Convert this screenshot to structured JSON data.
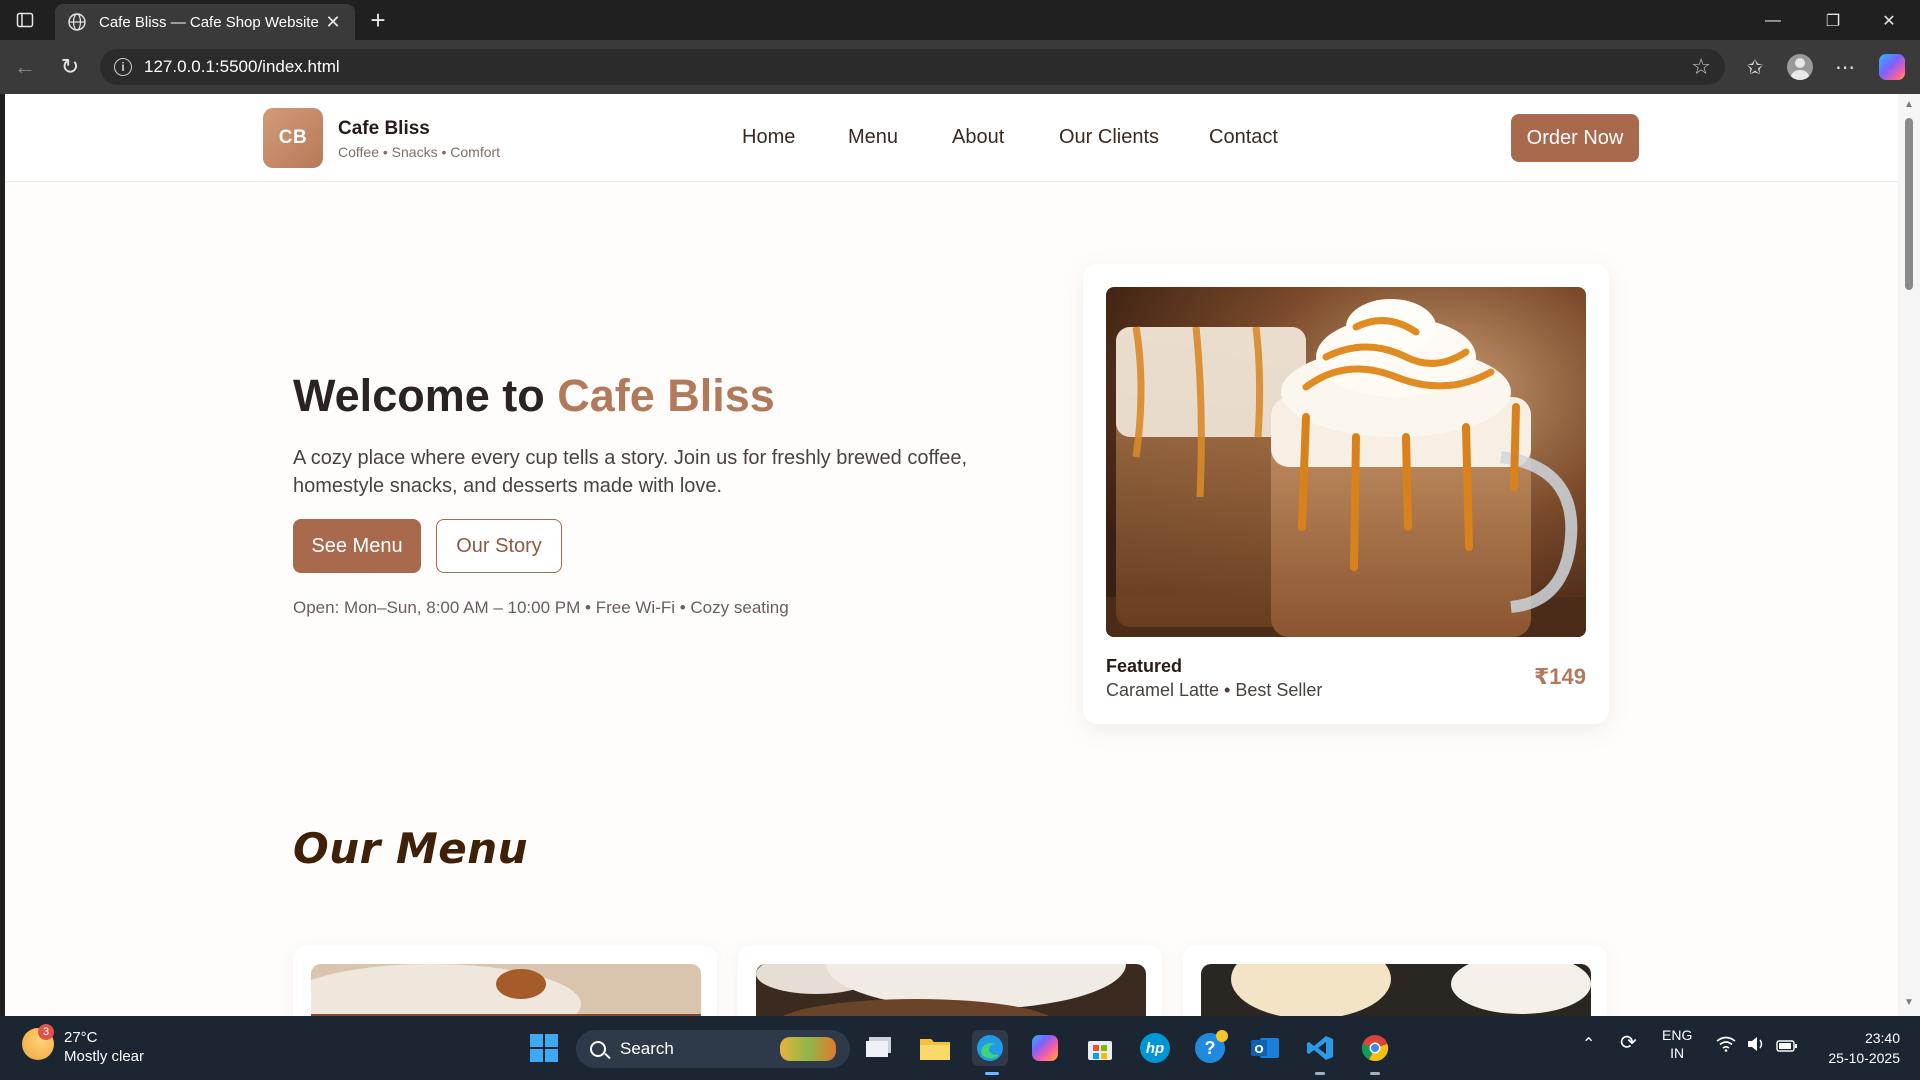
{
  "browser": {
    "tab_title": "Cafe Bliss — Cafe Shop Website",
    "url": "127.0.0.1:5500/index.html"
  },
  "site": {
    "logo_initials": "CB",
    "brand_name": "Cafe Bliss",
    "brand_tagline": "Coffee • Snacks • Comfort",
    "nav": [
      "Home",
      "Menu",
      "About",
      "Our Clients",
      "Contact"
    ],
    "order_button": "Order Now"
  },
  "hero": {
    "title_prefix": "Welcome to ",
    "title_accent": "Cafe Bliss",
    "description": "A cozy place where every cup tells a story. Join us for freshly brewed coffee, homestyle snacks, and desserts made with love.",
    "primary_button": "See Menu",
    "secondary_button": "Our Story",
    "hours": "Open: Mon–Sun, 8:00 AM – 10:00 PM • Free Wi-Fi • Cozy seating"
  },
  "featured": {
    "label": "Featured",
    "item": "Caramel Latte • Best Seller",
    "price": "₹149"
  },
  "menu_section": {
    "title": "Our Menu"
  },
  "taskbar": {
    "weather_temp": "27°C",
    "weather_desc": "Mostly clear",
    "weather_badge": "3",
    "search_label": "Search",
    "lang_line1": "ENG",
    "lang_line2": "IN",
    "time": "23:40",
    "date": "25-10-2025"
  },
  "colors": {
    "accent": "#a8694c",
    "accent_text": "#b27a5a",
    "page_bg": "#fffdfc",
    "section_title": "#3f2108"
  }
}
